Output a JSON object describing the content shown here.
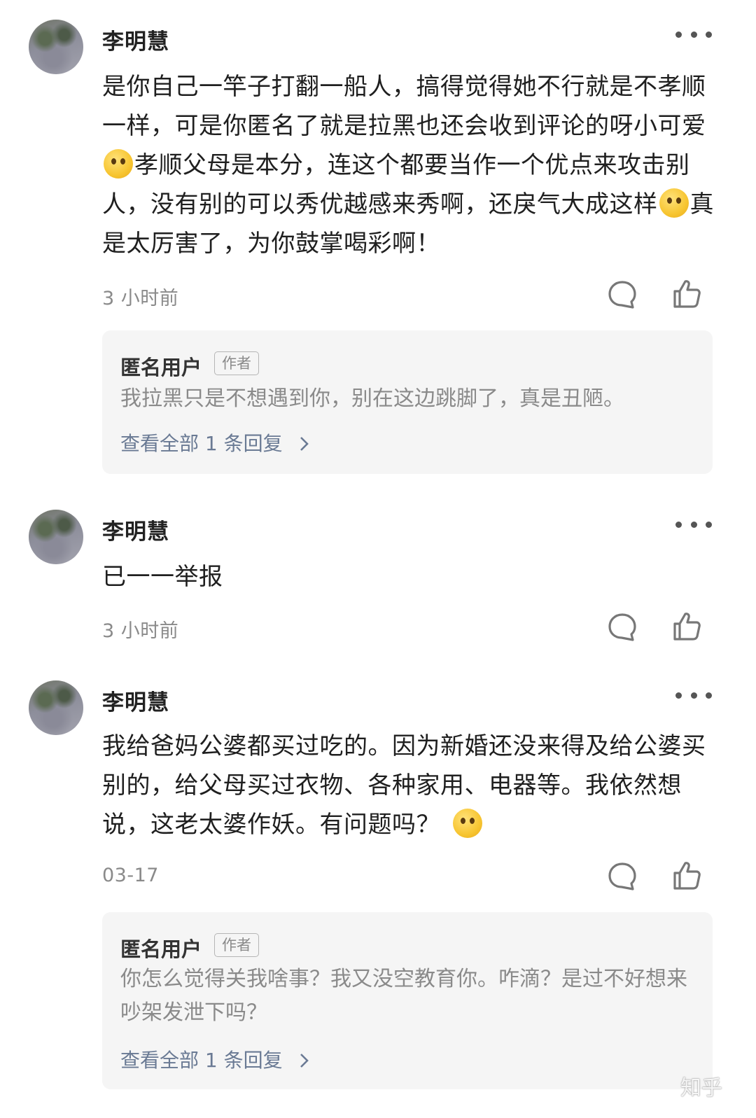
{
  "comments": [
    {
      "author": "李明慧",
      "content_parts": [
        "是你自己一竿子打翻一船人，搞得觉得她不行就是不孝顺一样，可是你匿名了就是拉黑也还会收到评论的呀小可爱",
        "孝顺父母是本分，连这个都要当作一个优点来攻击别人，没有别的可以秀优越感来秀啊，还戾气大成这样",
        "真是太厉害了，为你鼓掌喝彩啊！"
      ],
      "time": "3 小时前",
      "reply": {
        "author": "匿名用户",
        "badge": "作者",
        "text": "我拉黑只是不想遇到你，别在这边跳脚了，真是丑陋。",
        "view_all": "查看全部 1 条回复"
      }
    },
    {
      "author": "李明慧",
      "content": "已一一举报",
      "time": "3 小时前"
    },
    {
      "author": "李明慧",
      "content_parts": [
        "我给爸妈公婆都买过吃的。因为新婚还没来得及给公婆买别的，给父母买过衣物、各种家用、电器等。我依然想说，这老太婆作妖。有问题吗？"
      ],
      "time": "03-17",
      "reply": {
        "author": "匿名用户",
        "badge": "作者",
        "text": "你怎么觉得关我啥事？我又没空教育你。咋滴？是过不好想来吵架发泄下吗？",
        "view_all": "查看全部 1 条回复"
      }
    }
  ],
  "watermark": "知乎",
  "icons": {
    "more": "more-dots-icon",
    "reply": "comment-bubble-icon",
    "like": "thumbs-up-icon",
    "chevron": "chevron-right-icon",
    "emoji": "emoji-icon"
  }
}
